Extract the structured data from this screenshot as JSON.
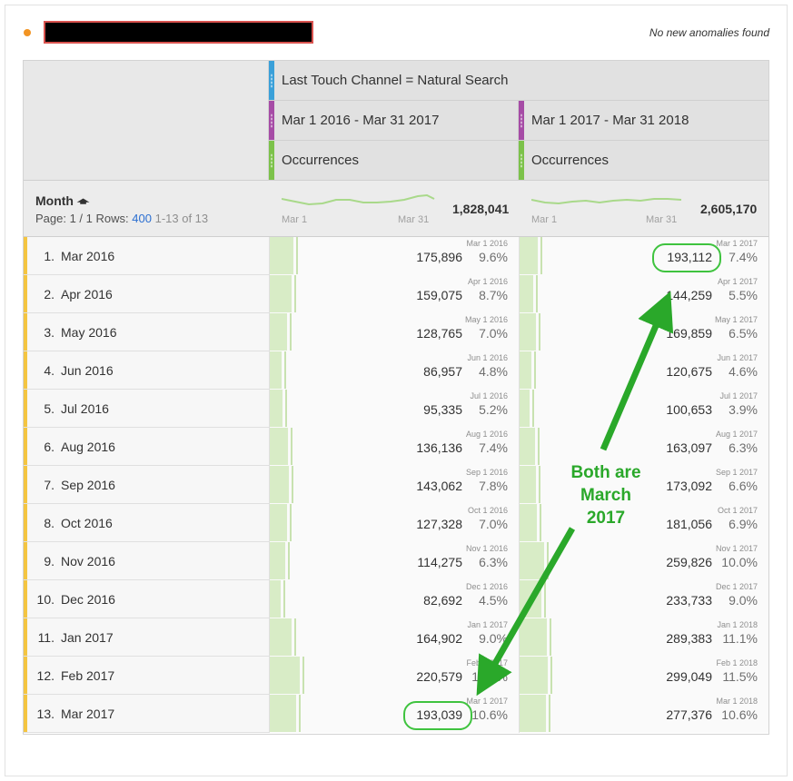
{
  "header": {
    "anomaly_text": "No new anomalies found"
  },
  "columns": {
    "segment": "Last Touch Channel = Natural Search",
    "ranges": [
      "Mar 1 2016 - Mar 31 2017",
      "Mar 1 2017 - Mar 31 2018"
    ],
    "metric": "Occurrences"
  },
  "dimension": {
    "label": "Month",
    "sort_icon": "arrow-up-icon",
    "page_label": "Page: 1 / 1",
    "rows_label": "Rows:",
    "rows_value": "400",
    "range_text": "1-13 of 13"
  },
  "totals": {
    "col1": "1,828,041",
    "col2": "2,605,170",
    "spark_start": "Mar 1",
    "spark_end": "Mar 31"
  },
  "rows": [
    {
      "n": "1.",
      "label": "Mar 2016",
      "d1": "Mar 1 2016",
      "v1": "175,896",
      "p1": "9.6%",
      "d2": "Mar 1 2017",
      "v2": "193,112",
      "p2": "7.4%",
      "f1": 0.096,
      "f2": 0.074
    },
    {
      "n": "2.",
      "label": "Apr 2016",
      "d1": "Apr 1 2016",
      "v1": "159,075",
      "p1": "8.7%",
      "d2": "Apr 1 2017",
      "v2": "144,259",
      "p2": "5.5%",
      "f1": 0.087,
      "f2": 0.055
    },
    {
      "n": "3.",
      "label": "May 2016",
      "d1": "May 1 2016",
      "v1": "128,765",
      "p1": "7.0%",
      "d2": "May 1 2017",
      "v2": "169,859",
      "p2": "6.5%",
      "f1": 0.07,
      "f2": 0.065
    },
    {
      "n": "4.",
      "label": "Jun 2016",
      "d1": "Jun 1 2016",
      "v1": "86,957",
      "p1": "4.8%",
      "d2": "Jun 1 2017",
      "v2": "120,675",
      "p2": "4.6%",
      "f1": 0.048,
      "f2": 0.046
    },
    {
      "n": "5.",
      "label": "Jul 2016",
      "d1": "Jul 1 2016",
      "v1": "95,335",
      "p1": "5.2%",
      "d2": "Jul 1 2017",
      "v2": "100,653",
      "p2": "3.9%",
      "f1": 0.052,
      "f2": 0.039
    },
    {
      "n": "6.",
      "label": "Aug 2016",
      "d1": "Aug 1 2016",
      "v1": "136,136",
      "p1": "7.4%",
      "d2": "Aug 1 2017",
      "v2": "163,097",
      "p2": "6.3%",
      "f1": 0.074,
      "f2": 0.063
    },
    {
      "n": "7.",
      "label": "Sep 2016",
      "d1": "Sep 1 2016",
      "v1": "143,062",
      "p1": "7.8%",
      "d2": "Sep 1 2017",
      "v2": "173,092",
      "p2": "6.6%",
      "f1": 0.078,
      "f2": 0.066
    },
    {
      "n": "8.",
      "label": "Oct 2016",
      "d1": "Oct 1 2016",
      "v1": "127,328",
      "p1": "7.0%",
      "d2": "Oct 1 2017",
      "v2": "181,056",
      "p2": "6.9%",
      "f1": 0.07,
      "f2": 0.069
    },
    {
      "n": "9.",
      "label": "Nov 2016",
      "d1": "Nov 1 2016",
      "v1": "114,275",
      "p1": "6.3%",
      "d2": "Nov 1 2017",
      "v2": "259,826",
      "p2": "10.0%",
      "f1": 0.063,
      "f2": 0.1
    },
    {
      "n": "10.",
      "label": "Dec 2016",
      "d1": "Dec 1 2016",
      "v1": "82,692",
      "p1": "4.5%",
      "d2": "Dec 1 2017",
      "v2": "233,733",
      "p2": "9.0%",
      "f1": 0.045,
      "f2": 0.09
    },
    {
      "n": "11.",
      "label": "Jan 2017",
      "d1": "Jan 1 2017",
      "v1": "164,902",
      "p1": "9.0%",
      "d2": "Jan 1 2018",
      "v2": "289,383",
      "p2": "11.1%",
      "f1": 0.09,
      "f2": 0.111
    },
    {
      "n": "12.",
      "label": "Feb 2017",
      "d1": "Feb 1 2017",
      "v1": "220,579",
      "p1": "12.1%",
      "d2": "Feb 1 2018",
      "v2": "299,049",
      "p2": "11.5%",
      "f1": 0.121,
      "f2": 0.115
    },
    {
      "n": "13.",
      "label": "Mar 2017",
      "d1": "Mar 1 2017",
      "v1": "193,039",
      "p1": "10.6%",
      "d2": "Mar 1 2018",
      "v2": "277,376",
      "p2": "10.6%",
      "f1": 0.106,
      "f2": 0.106
    }
  ],
  "annotation": {
    "lines": [
      "Both are",
      "March",
      "2017"
    ],
    "color": "#2aa82a"
  },
  "colors": {
    "segment_tag": "#3aa0d9",
    "range_tag": "#a64ca6",
    "metric_tag": "#7cc24a",
    "row_bar": "#f4c542",
    "highlight": "#3fc33f"
  }
}
